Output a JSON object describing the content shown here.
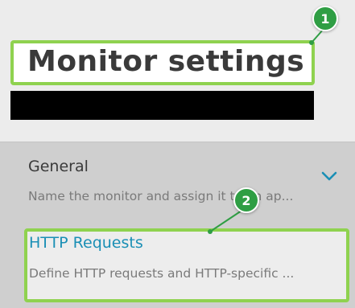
{
  "header": {
    "title": "Monitor settings"
  },
  "sections": [
    {
      "title": "General",
      "description": "Name the monitor and assign it to an ap..."
    },
    {
      "title": "HTTP Requests",
      "description": "Define HTTP requests and HTTP-specific ..."
    }
  ],
  "annotations": {
    "badge_1": "1",
    "badge_2": "2"
  },
  "colors": {
    "highlight": "#8fd24f",
    "badge": "#2f9e44",
    "link": "#1a8fb5"
  },
  "icons": {
    "expand": "chevron-down-icon"
  }
}
